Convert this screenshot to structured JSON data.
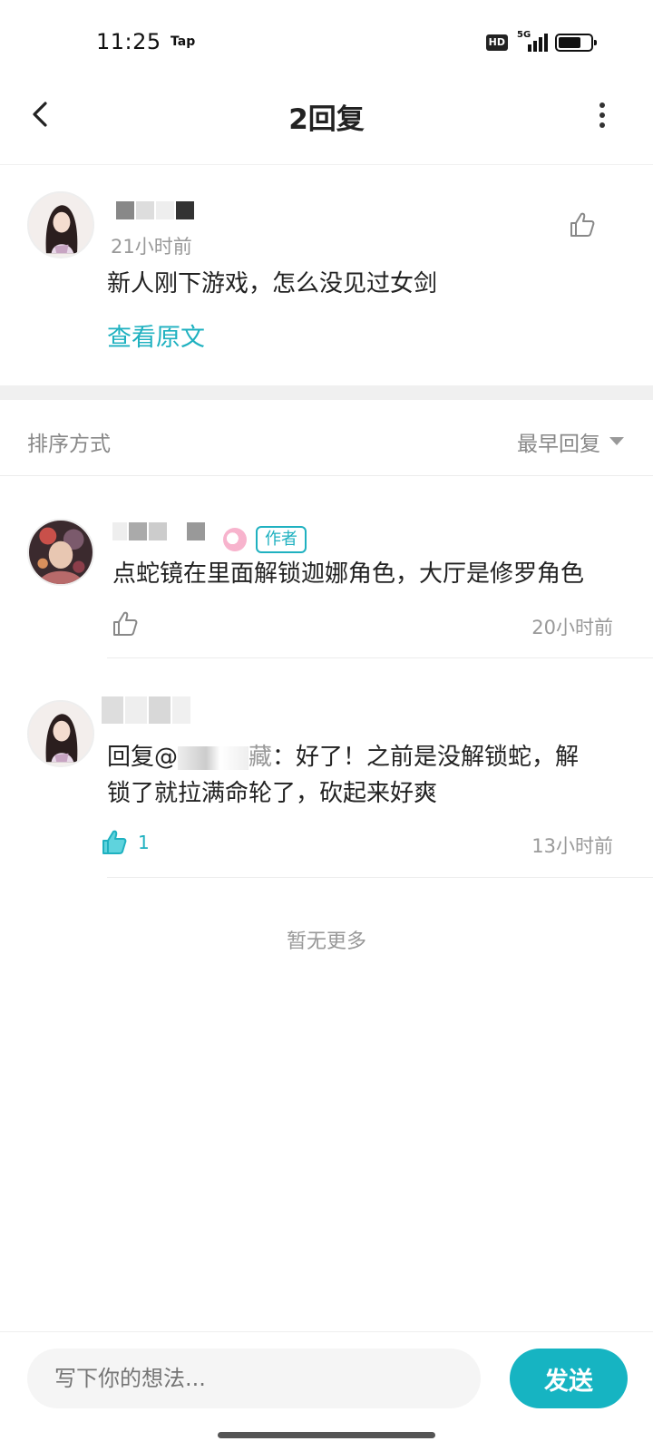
{
  "status_bar": {
    "time": "11:25",
    "app_label": "Tap",
    "hd": "HD",
    "network": "5G"
  },
  "header": {
    "title": "2回复"
  },
  "original_post": {
    "time": "21小时前",
    "text": "新人刚下游戏，怎么没见过女剑",
    "view_original": "查看原文"
  },
  "sort": {
    "label": "排序方式",
    "value": "最早回复"
  },
  "replies": [
    {
      "tag": "作者",
      "text": "点蛇镜在里面解锁迦娜角色，大厅是修罗角色",
      "time": "20小时前"
    },
    {
      "reply_prefix": "回复@",
      "reply_target_suffix": "藏",
      "text_line1": "：好了！之前是没解锁蛇，解",
      "text_line2": "锁了就拉满命轮了，砍起来好爽",
      "likes": "1",
      "time": "13小时前"
    }
  ],
  "end_text": "暂无更多",
  "composer": {
    "placeholder": "写下你的想法...",
    "send_label": "发送"
  },
  "colors": {
    "accent": "#1fb1c0",
    "send_bg": "#16b4c2"
  }
}
